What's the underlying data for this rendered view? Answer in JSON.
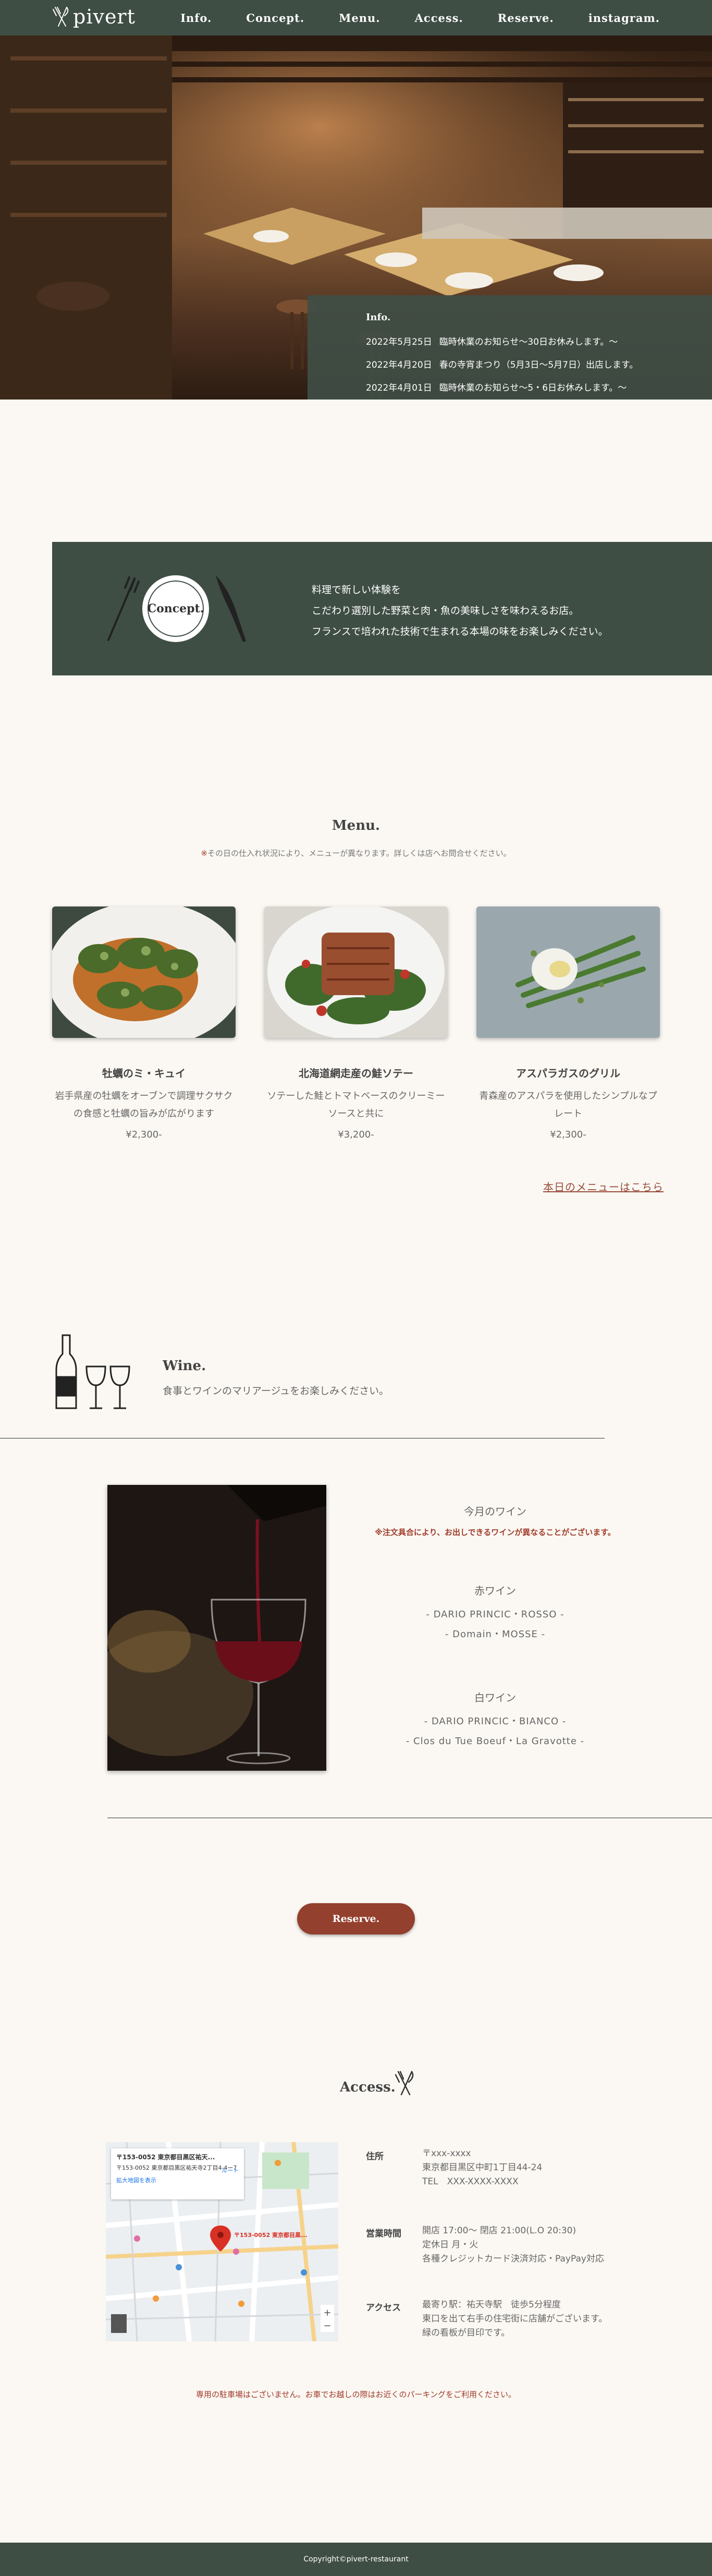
{
  "header": {
    "logo": "pivert",
    "nav": [
      "Info.",
      "Concept.",
      "Menu.",
      "Access.",
      "Reserve.",
      "instagram."
    ]
  },
  "info": {
    "title": "Info.",
    "items": [
      {
        "date": "2022年5月25日",
        "text": "臨時休業のお知らせ〜30日お休みします。〜"
      },
      {
        "date": "2022年4月20日",
        "text": "春の寺宵まつり（5月3日〜5月7日）出店します。"
      },
      {
        "date": "2022年4月01日",
        "text": "臨時休業のお知らせ〜5・6日お休みします。〜"
      }
    ]
  },
  "concept": {
    "label": "Concept.",
    "lines": [
      "料理で新しい体験を",
      "こだわり選別した野菜と肉・魚の美味しさを味わえるお店。",
      "フランスで培われた技術で生まれる本場の味をお楽しみください。"
    ]
  },
  "menu": {
    "title": "Menu.",
    "note_star": "※",
    "note": "その日の仕入れ状況により、メニューが異なります。詳しくは店へお問合せください。",
    "items": [
      {
        "name": "牡蠣のミ・キュイ",
        "desc": "岩手県産の牡蠣をオーブンで調理サクサクの食感と牡蠣の旨みが広がります",
        "price": "¥2,300-"
      },
      {
        "name": "北海道網走産の鮭ソテー",
        "desc": "ソテーした鮭とトマトベースのクリーミーソースと共に",
        "price": "¥3,200-"
      },
      {
        "name": "アスパラガスのグリル",
        "desc": "青森産のアスパラを使用したシンプルなプレート",
        "price": "¥2,300-"
      }
    ],
    "link": "本日のメニューはこちら"
  },
  "wine": {
    "title": "Wine.",
    "subtitle": "食事とワインのマリアージュをお楽しみください。",
    "today": "今月のワイン",
    "note": "※注文具合により、お出しできるワインが異なることがございます。",
    "red_label": "赤ワイン",
    "red": [
      "- DARIO PRINCIC・ROSSO -",
      "- Domain・MOSSE -"
    ],
    "white_label": "白ワイン",
    "white": [
      "- DARIO PRINCIC・BIANCO -",
      "- Clos du Tue Boeuf・La Gravotte -"
    ]
  },
  "reserve": {
    "label": "Reserve."
  },
  "access": {
    "title": "Access.",
    "map": {
      "card_title": "〒153-0052 東京都目黒区祐天...",
      "card_addr": "〒153-0052 東京都目黒区祐天寺2丁目4-4ー7",
      "card_link": "拡大地図を表示",
      "route": "ルート",
      "pin_label": "〒153-0052 東京都目黒..."
    },
    "rows": [
      {
        "label": "住所",
        "lines": [
          "〒xxx-xxxx",
          "東京都目黒区中町1丁目44-24",
          "TEL　XXX-XXXX-XXXX"
        ]
      },
      {
        "label": "営業時間",
        "lines": [
          "開店 17:00〜 閉店 21:00(L.O 20:30)",
          "定休日 月・火",
          "各種クレジットカード決済対応・PayPay対応"
        ]
      },
      {
        "label": "アクセス",
        "lines": [
          "最寄り駅：祐天寺駅　徒歩5分程度",
          "東口を出て右手の住宅街に店舗がございます。",
          "緑の看板が目印です。"
        ]
      }
    ],
    "parking": "専用の駐車場はございません。お車でお越しの際はお近くのパーキングをご利用ください。"
  },
  "footer": {
    "copyright": "Copyright©pivert-restaurant"
  }
}
